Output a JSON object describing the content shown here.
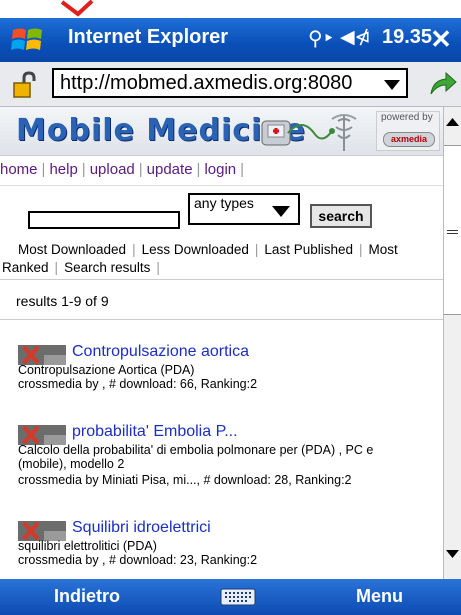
{
  "window": {
    "title": "Internet Explorer",
    "clock": "19.35",
    "signal_icon": "signal-icon",
    "speaker_icon": "speaker-icon",
    "close_icon": "close-icon"
  },
  "address": {
    "url": "http://mobmed.axmedis.org:8080"
  },
  "banner": {
    "logo_text": "Mobile Medicine",
    "powered_by": "powered by",
    "powered_logo": "axmedia"
  },
  "nav": {
    "links": [
      "home",
      "help",
      "upload",
      "update",
      "login"
    ]
  },
  "search": {
    "input_value": "",
    "type_selected": "any types",
    "button_label": "search"
  },
  "tabs": {
    "row1": [
      "Most Downloaded",
      "Less Downloaded",
      "Last Published",
      "Most"
    ],
    "row2": [
      "Ranked",
      "Search results"
    ]
  },
  "results": {
    "summary": "results 1-9 of 9",
    "items": [
      {
        "title": "Contropulsazione aortica",
        "subtitle": "Contropulsazione Aortica (PDA)",
        "meta": "crossmedia by , # download: 66, Ranking:2"
      },
      {
        "title": "probabilita' Embolia P...",
        "subtitle": "Calcolo della probabilita' di embolia polmonare per (PDA) , PC e (mobile), modello 2",
        "meta": "crossmedia by Miniati Pisa, mi..., # download: 28, Ranking:2"
      },
      {
        "title": "Squilibri idroelettrici",
        "subtitle": "squilibri elettrolitici (PDA)",
        "meta": "crossmedia by , # download: 23, Ranking:2"
      }
    ]
  },
  "softkeys": {
    "left": "Indietro",
    "right": "Menu"
  },
  "colors": {
    "titlebar": "#0a4fb8",
    "link": "#1a2ec8",
    "logo": "#2a62b6"
  }
}
